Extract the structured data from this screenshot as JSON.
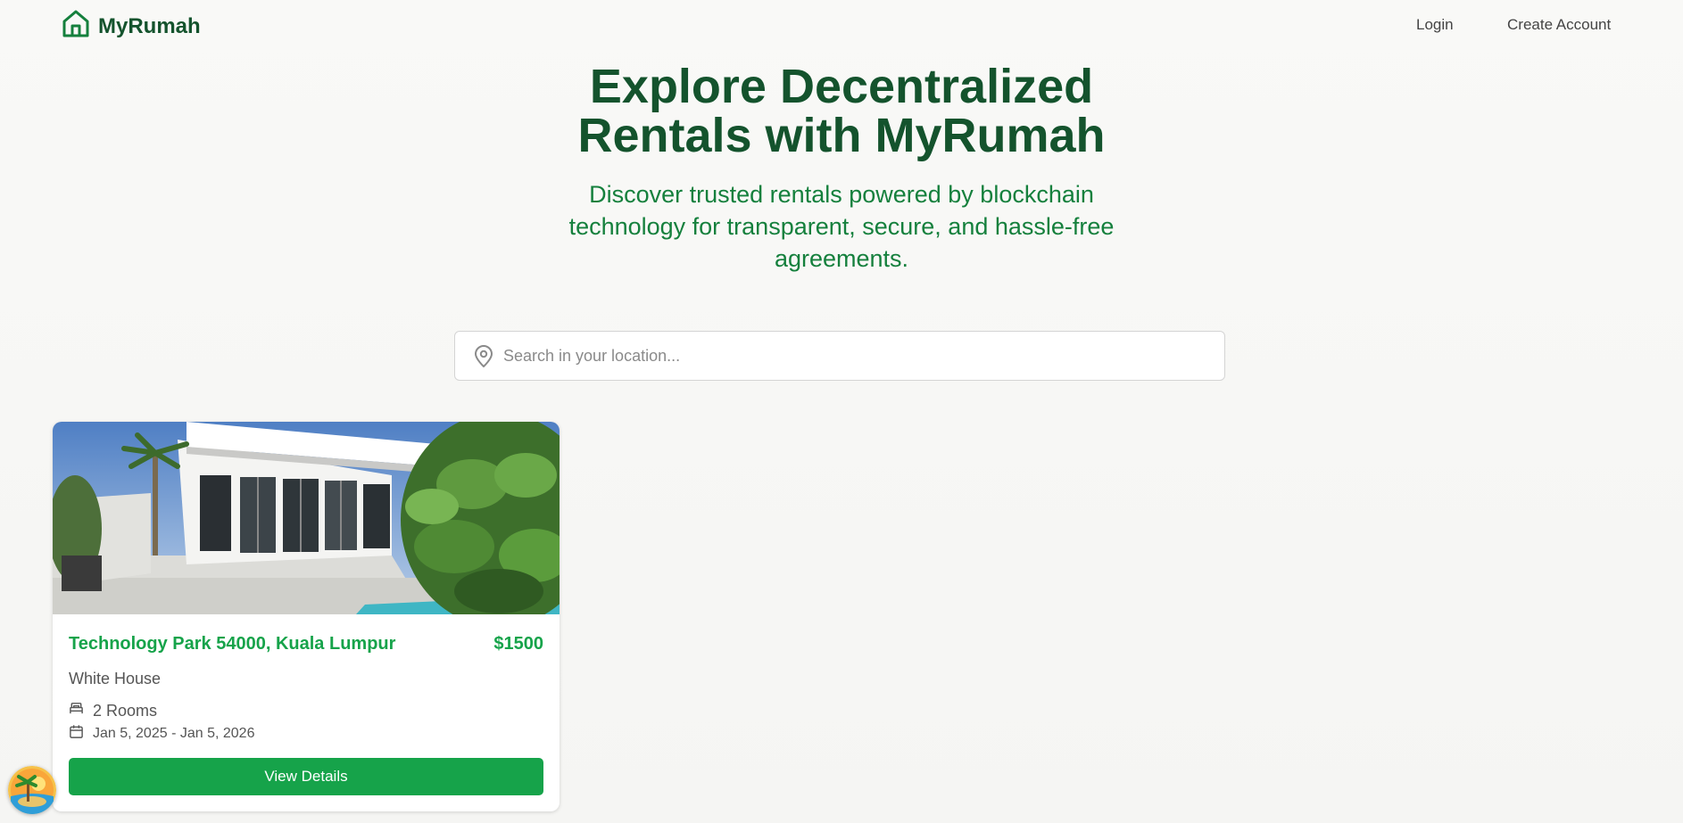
{
  "header": {
    "brand_name": "MyRumah",
    "logo_icon": "home-icon",
    "nav": {
      "login_label": "Login",
      "create_account_label": "Create Account"
    }
  },
  "hero": {
    "title": "Explore Decentralized Rentals with MyRumah",
    "subtitle": "Discover trusted rentals powered by blockchain technology for transparent, secure, and hassle-free agreements."
  },
  "search": {
    "icon": "map-pin-icon",
    "placeholder": "Search in your location...",
    "value": ""
  },
  "listings": [
    {
      "location": "Technology Park 54000, Kuala Lumpur",
      "price": "$1500",
      "name": "White House",
      "rooms_icon": "bed-icon",
      "rooms": "2 Rooms",
      "dates_icon": "calendar-icon",
      "dates": "Jan 5, 2025 - Jan 5, 2026",
      "button_label": "View Details"
    }
  ],
  "colors": {
    "brand_dark": "#14532d",
    "brand_green": "#15803d",
    "accent": "#16a34a"
  }
}
